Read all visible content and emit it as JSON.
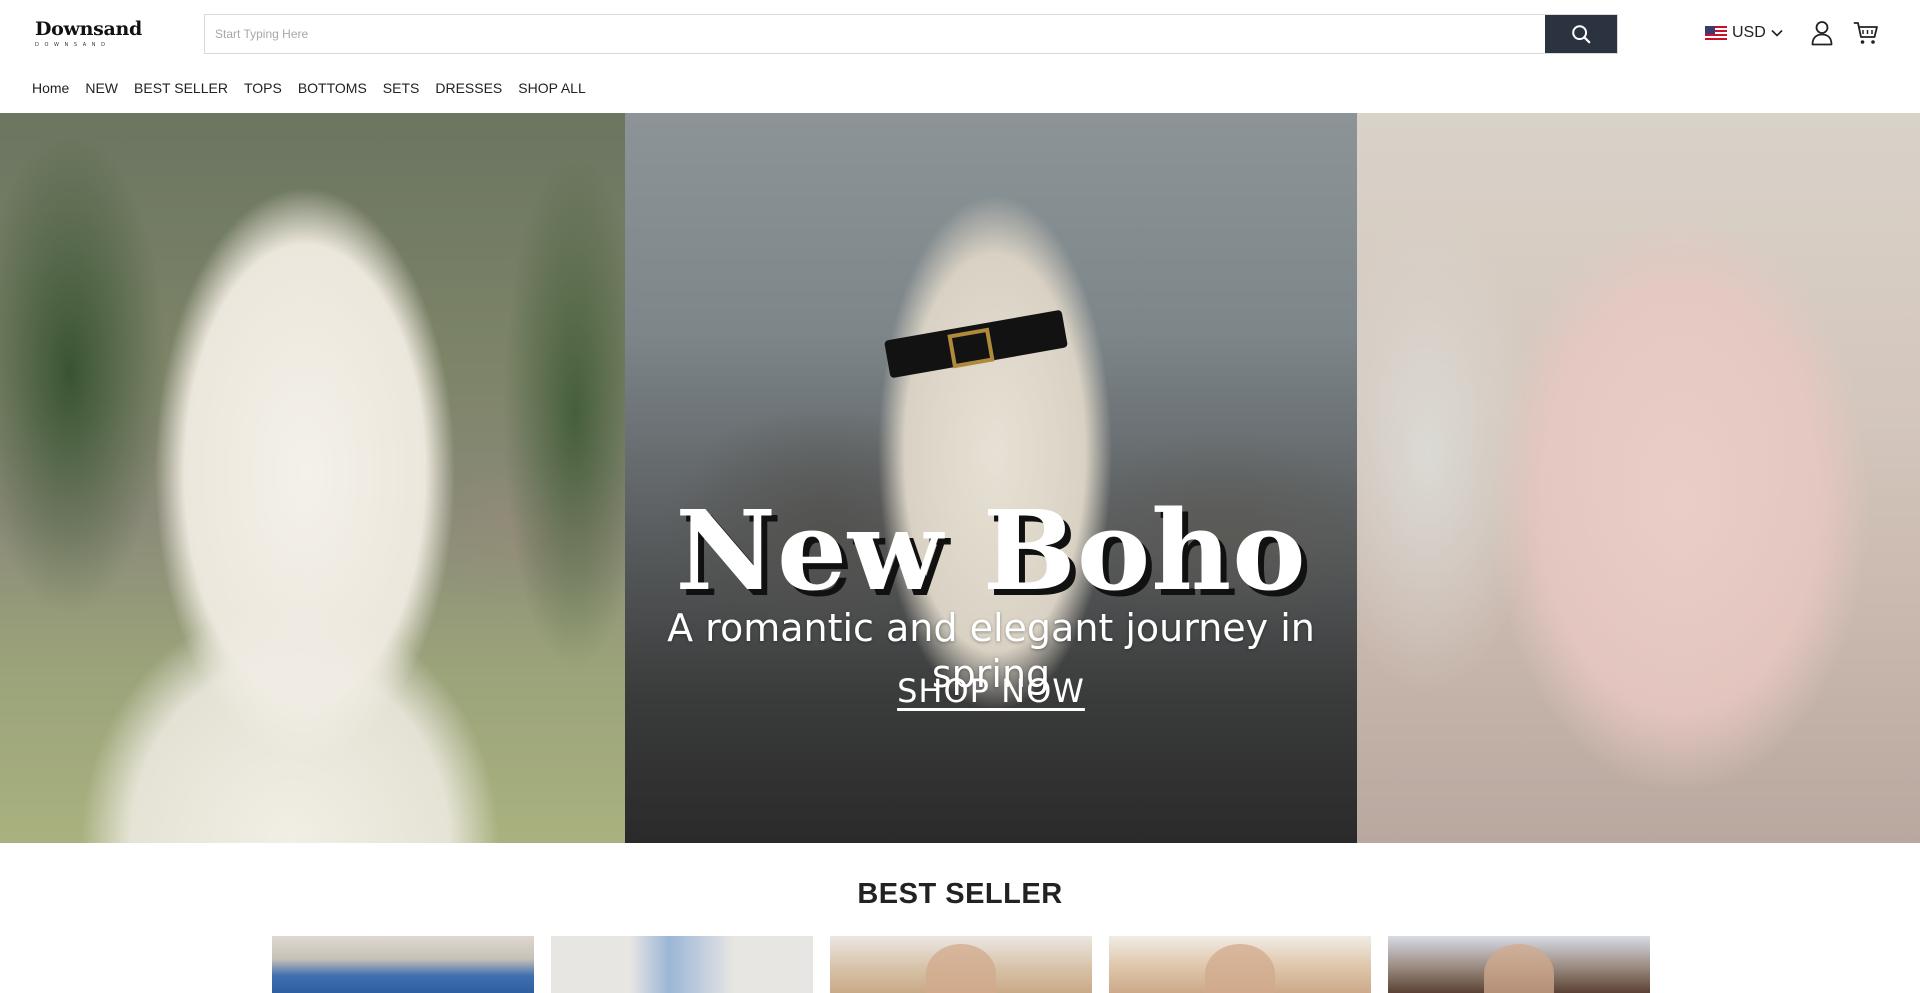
{
  "brand": {
    "name": "Downsand",
    "tagline": "DOWNSAND"
  },
  "search": {
    "placeholder": "Start Typing Here",
    "value": ""
  },
  "header": {
    "currency": "USD",
    "icons": {
      "search": "search-icon",
      "flag": "us-flag-icon",
      "dropdown": "chevron-down-icon",
      "account": "user-icon",
      "cart": "cart-icon"
    }
  },
  "nav": {
    "items": [
      {
        "label": "Home"
      },
      {
        "label": "NEW"
      },
      {
        "label": "BEST SELLER"
      },
      {
        "label": "TOPS"
      },
      {
        "label": "BOTTOMS"
      },
      {
        "label": "SETS"
      },
      {
        "label": "DRESSES"
      },
      {
        "label": "SHOP ALL"
      }
    ]
  },
  "hero": {
    "title": "New Boho",
    "subtitle": "A romantic and elegant journey in spring",
    "cta": "SHOP NOW"
  },
  "best_seller": {
    "title": "BEST SELLER",
    "product_count": 5
  },
  "colors": {
    "search_button": "#2b3340",
    "text": "#1b1b1b",
    "hero_text": "#ffffff"
  }
}
